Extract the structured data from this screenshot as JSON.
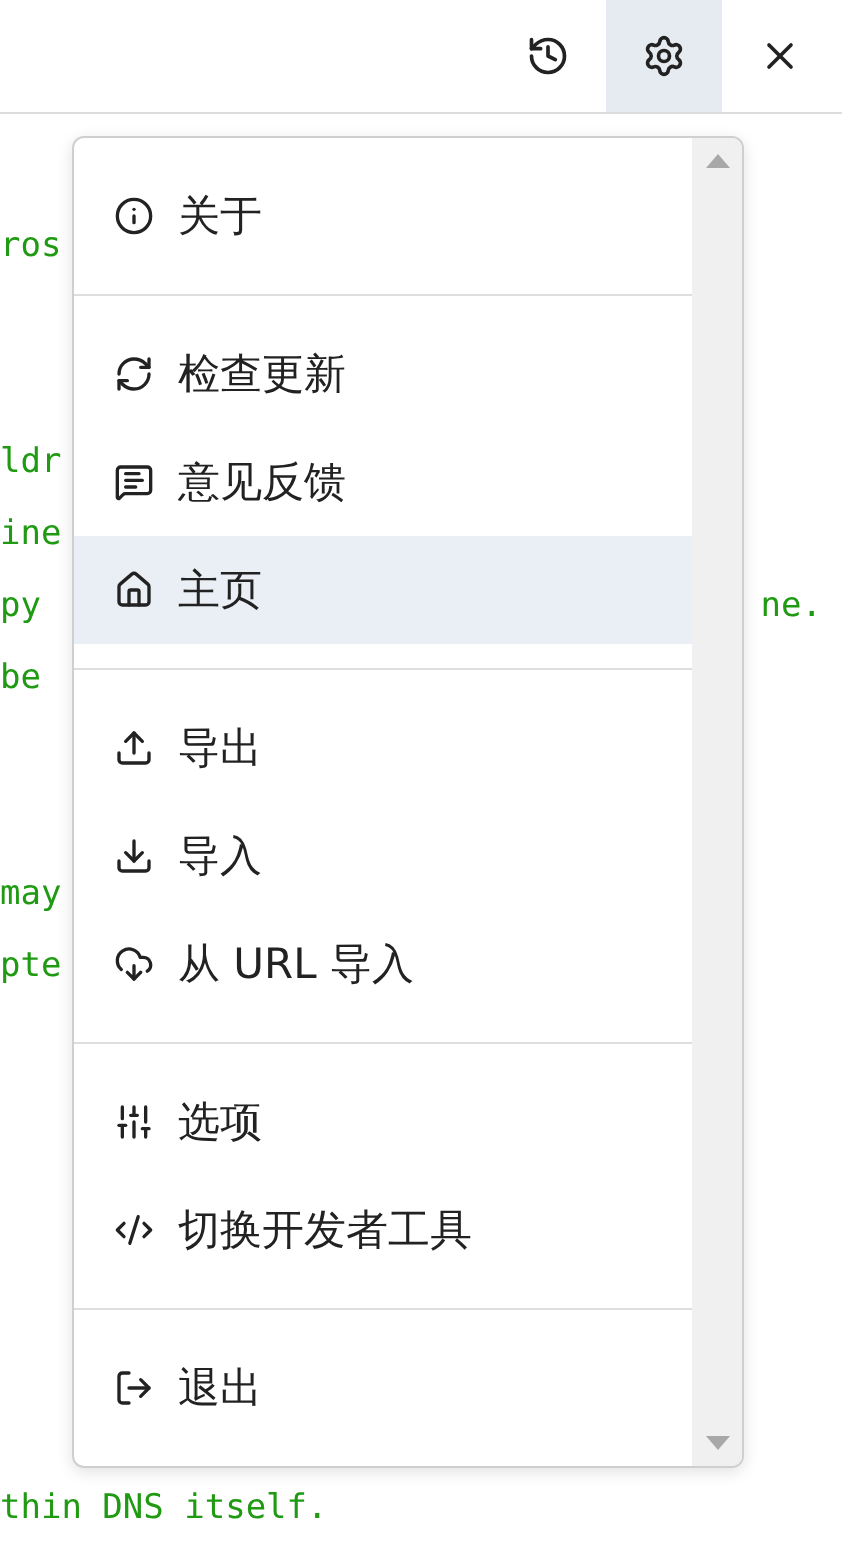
{
  "toolbar": [
    {
      "kind": "history",
      "selected": false
    },
    {
      "kind": "settings",
      "selected": true
    },
    {
      "kind": "close",
      "selected": false
    }
  ],
  "background_lines": [
    {
      "left": "ros"
    },
    {
      "left": "ldr"
    },
    {
      "left": "ine"
    },
    {
      "left": "py",
      "right": "ne."
    },
    {
      "left": "be"
    },
    {
      "left": "may"
    },
    {
      "left": "pte"
    },
    {
      "left": "thin DNS itself."
    }
  ],
  "menu": {
    "groups": [
      {
        "items": [
          {
            "kind": "info",
            "label": "关于",
            "highlighted": false
          }
        ]
      },
      {
        "items": [
          {
            "kind": "refresh",
            "label": "检查更新",
            "highlighted": false
          },
          {
            "kind": "feedback",
            "label": "意见反馈",
            "highlighted": false
          },
          {
            "kind": "home",
            "label": "主页",
            "highlighted": true
          }
        ]
      },
      {
        "items": [
          {
            "kind": "export",
            "label": "导出",
            "highlighted": false
          },
          {
            "kind": "import",
            "label": "导入",
            "highlighted": false
          },
          {
            "kind": "cloud",
            "label": "从 URL 导入",
            "highlighted": false
          }
        ]
      },
      {
        "items": [
          {
            "kind": "sliders",
            "label": "选项",
            "highlighted": false
          },
          {
            "kind": "code",
            "label": "切换开发者工具",
            "highlighted": false
          }
        ]
      },
      {
        "items": [
          {
            "kind": "logout",
            "label": "退出",
            "highlighted": false
          }
        ]
      }
    ]
  }
}
